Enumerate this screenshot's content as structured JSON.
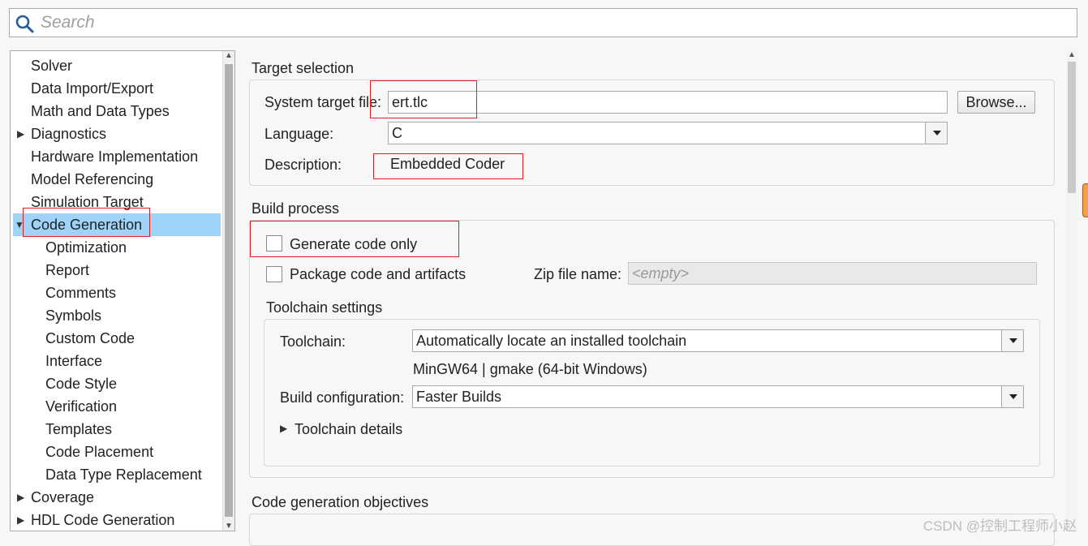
{
  "search": {
    "placeholder": "Search"
  },
  "tree": {
    "items": [
      {
        "label": "Solver"
      },
      {
        "label": "Data Import/Export"
      },
      {
        "label": "Math and Data Types"
      },
      {
        "label": "Diagnostics"
      },
      {
        "label": "Hardware Implementation"
      },
      {
        "label": "Model Referencing"
      },
      {
        "label": "Simulation Target"
      },
      {
        "label": "Code Generation"
      },
      {
        "label": "Optimization"
      },
      {
        "label": "Report"
      },
      {
        "label": "Comments"
      },
      {
        "label": "Symbols"
      },
      {
        "label": "Custom Code"
      },
      {
        "label": "Interface"
      },
      {
        "label": "Code Style"
      },
      {
        "label": "Verification"
      },
      {
        "label": "Templates"
      },
      {
        "label": "Code Placement"
      },
      {
        "label": "Data Type Replacement"
      },
      {
        "label": "Coverage"
      },
      {
        "label": "HDL Code Generation"
      }
    ]
  },
  "target_selection": {
    "title": "Target selection",
    "system_target_file_label": "System target file:",
    "system_target_file_value": "ert.tlc",
    "browse_label": "Browse...",
    "language_label": "Language:",
    "language_value": "C",
    "description_label": "Description:",
    "description_value": "Embedded Coder"
  },
  "build_process": {
    "title": "Build process",
    "generate_code_only_label": "Generate code only",
    "package_label": "Package code and artifacts",
    "zip_label": "Zip file name:",
    "zip_placeholder": "<empty>",
    "toolchain_settings_title": "Toolchain settings",
    "toolchain_label": "Toolchain:",
    "toolchain_value": "Automatically locate an installed toolchain",
    "toolchain_info": "MinGW64 | gmake (64-bit Windows)",
    "build_config_label": "Build configuration:",
    "build_config_value": "Faster Builds",
    "toolchain_details_label": "Toolchain details"
  },
  "objectives": {
    "title": "Code generation objectives"
  },
  "watermark": "CSDN @控制工程师小赵",
  "colors": {
    "selection": "#9fd3f8",
    "annotation_red": "#e02020"
  }
}
